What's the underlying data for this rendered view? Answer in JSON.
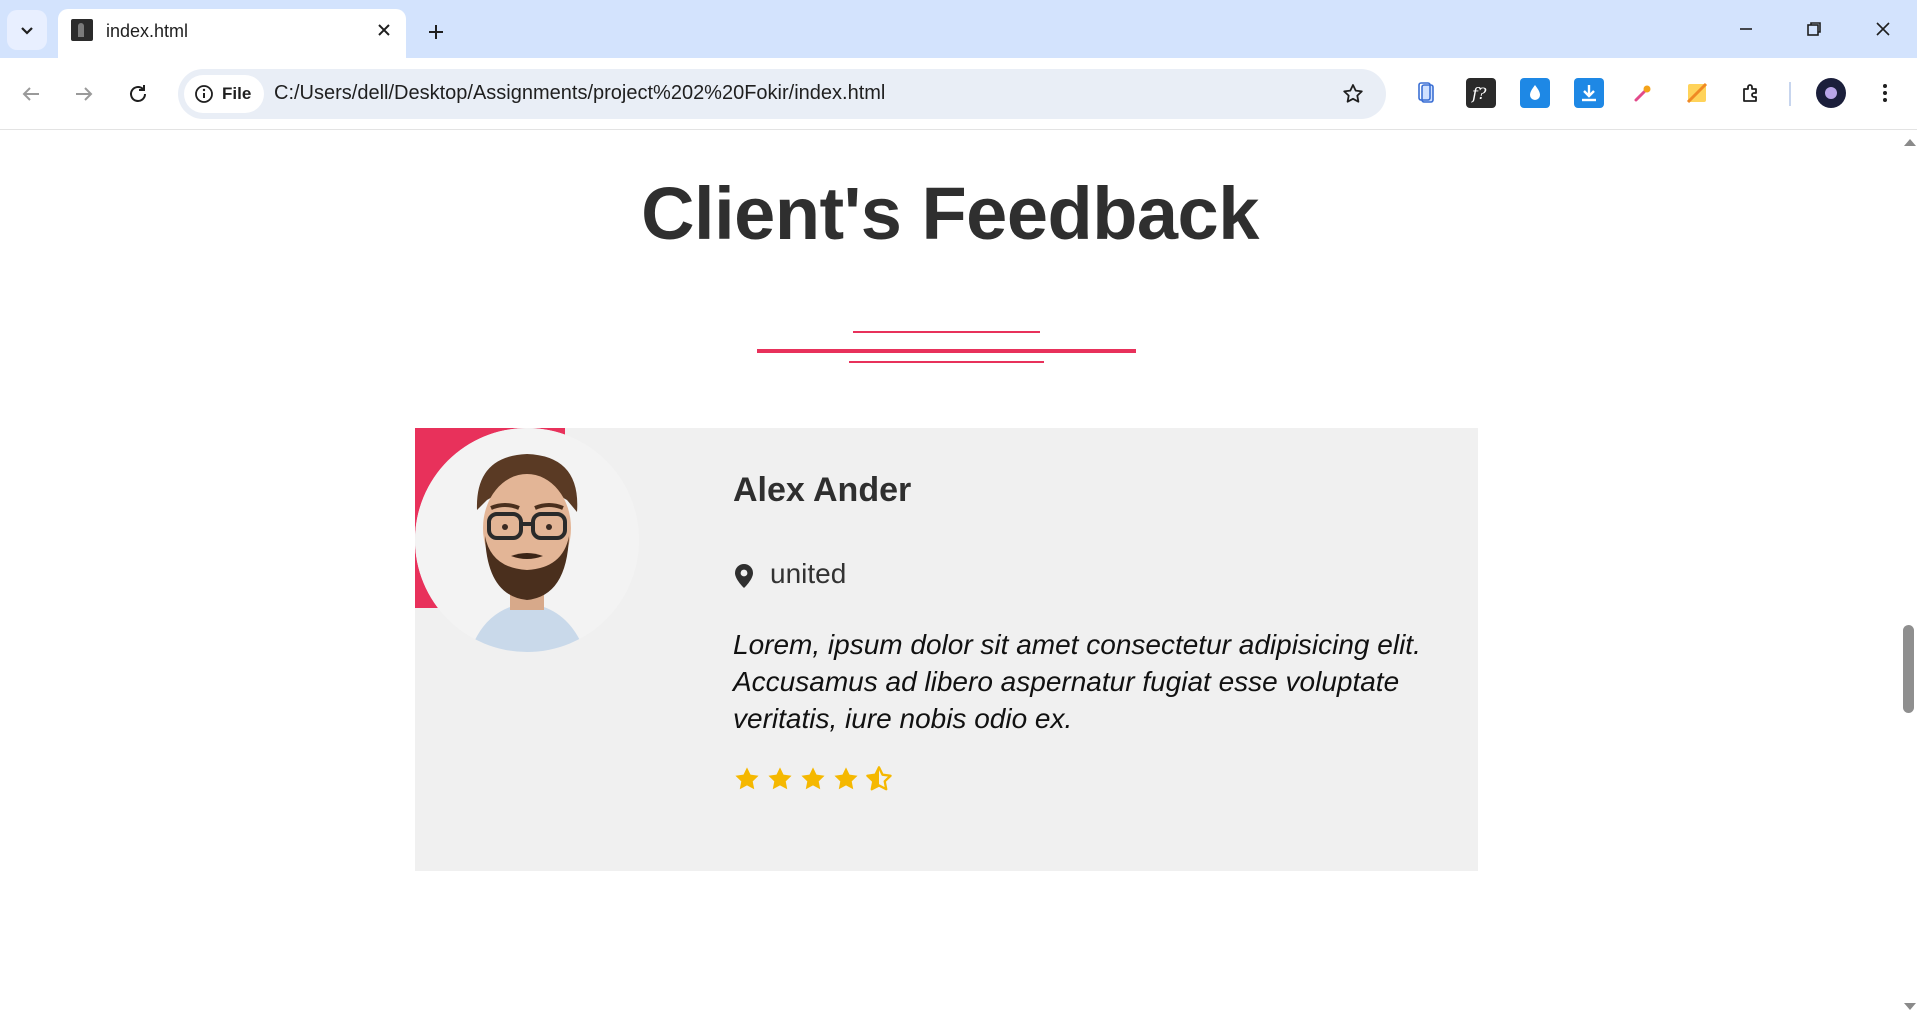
{
  "browser": {
    "tab_title": "index.html",
    "chip_label": "File",
    "url": "C:/Users/dell/Desktop/Assignments/project%202%20Fokir/index.html"
  },
  "page": {
    "section_title": "Client's Feedback",
    "testimonial": {
      "name": "Alex Ander",
      "location": "united",
      "quote": "Lorem, ipsum dolor sit amet consectetur adipisicing elit. Accusamus ad libero aspernatur fugiat esse voluptate veritatis, iure nobis odio ex.",
      "rating": 4.5,
      "rating_max": 5
    }
  },
  "colors": {
    "accent": "#e8315b",
    "star": "#f5b800",
    "card_bg": "#f0f0f0",
    "chrome_bg": "#d3e3fd"
  }
}
